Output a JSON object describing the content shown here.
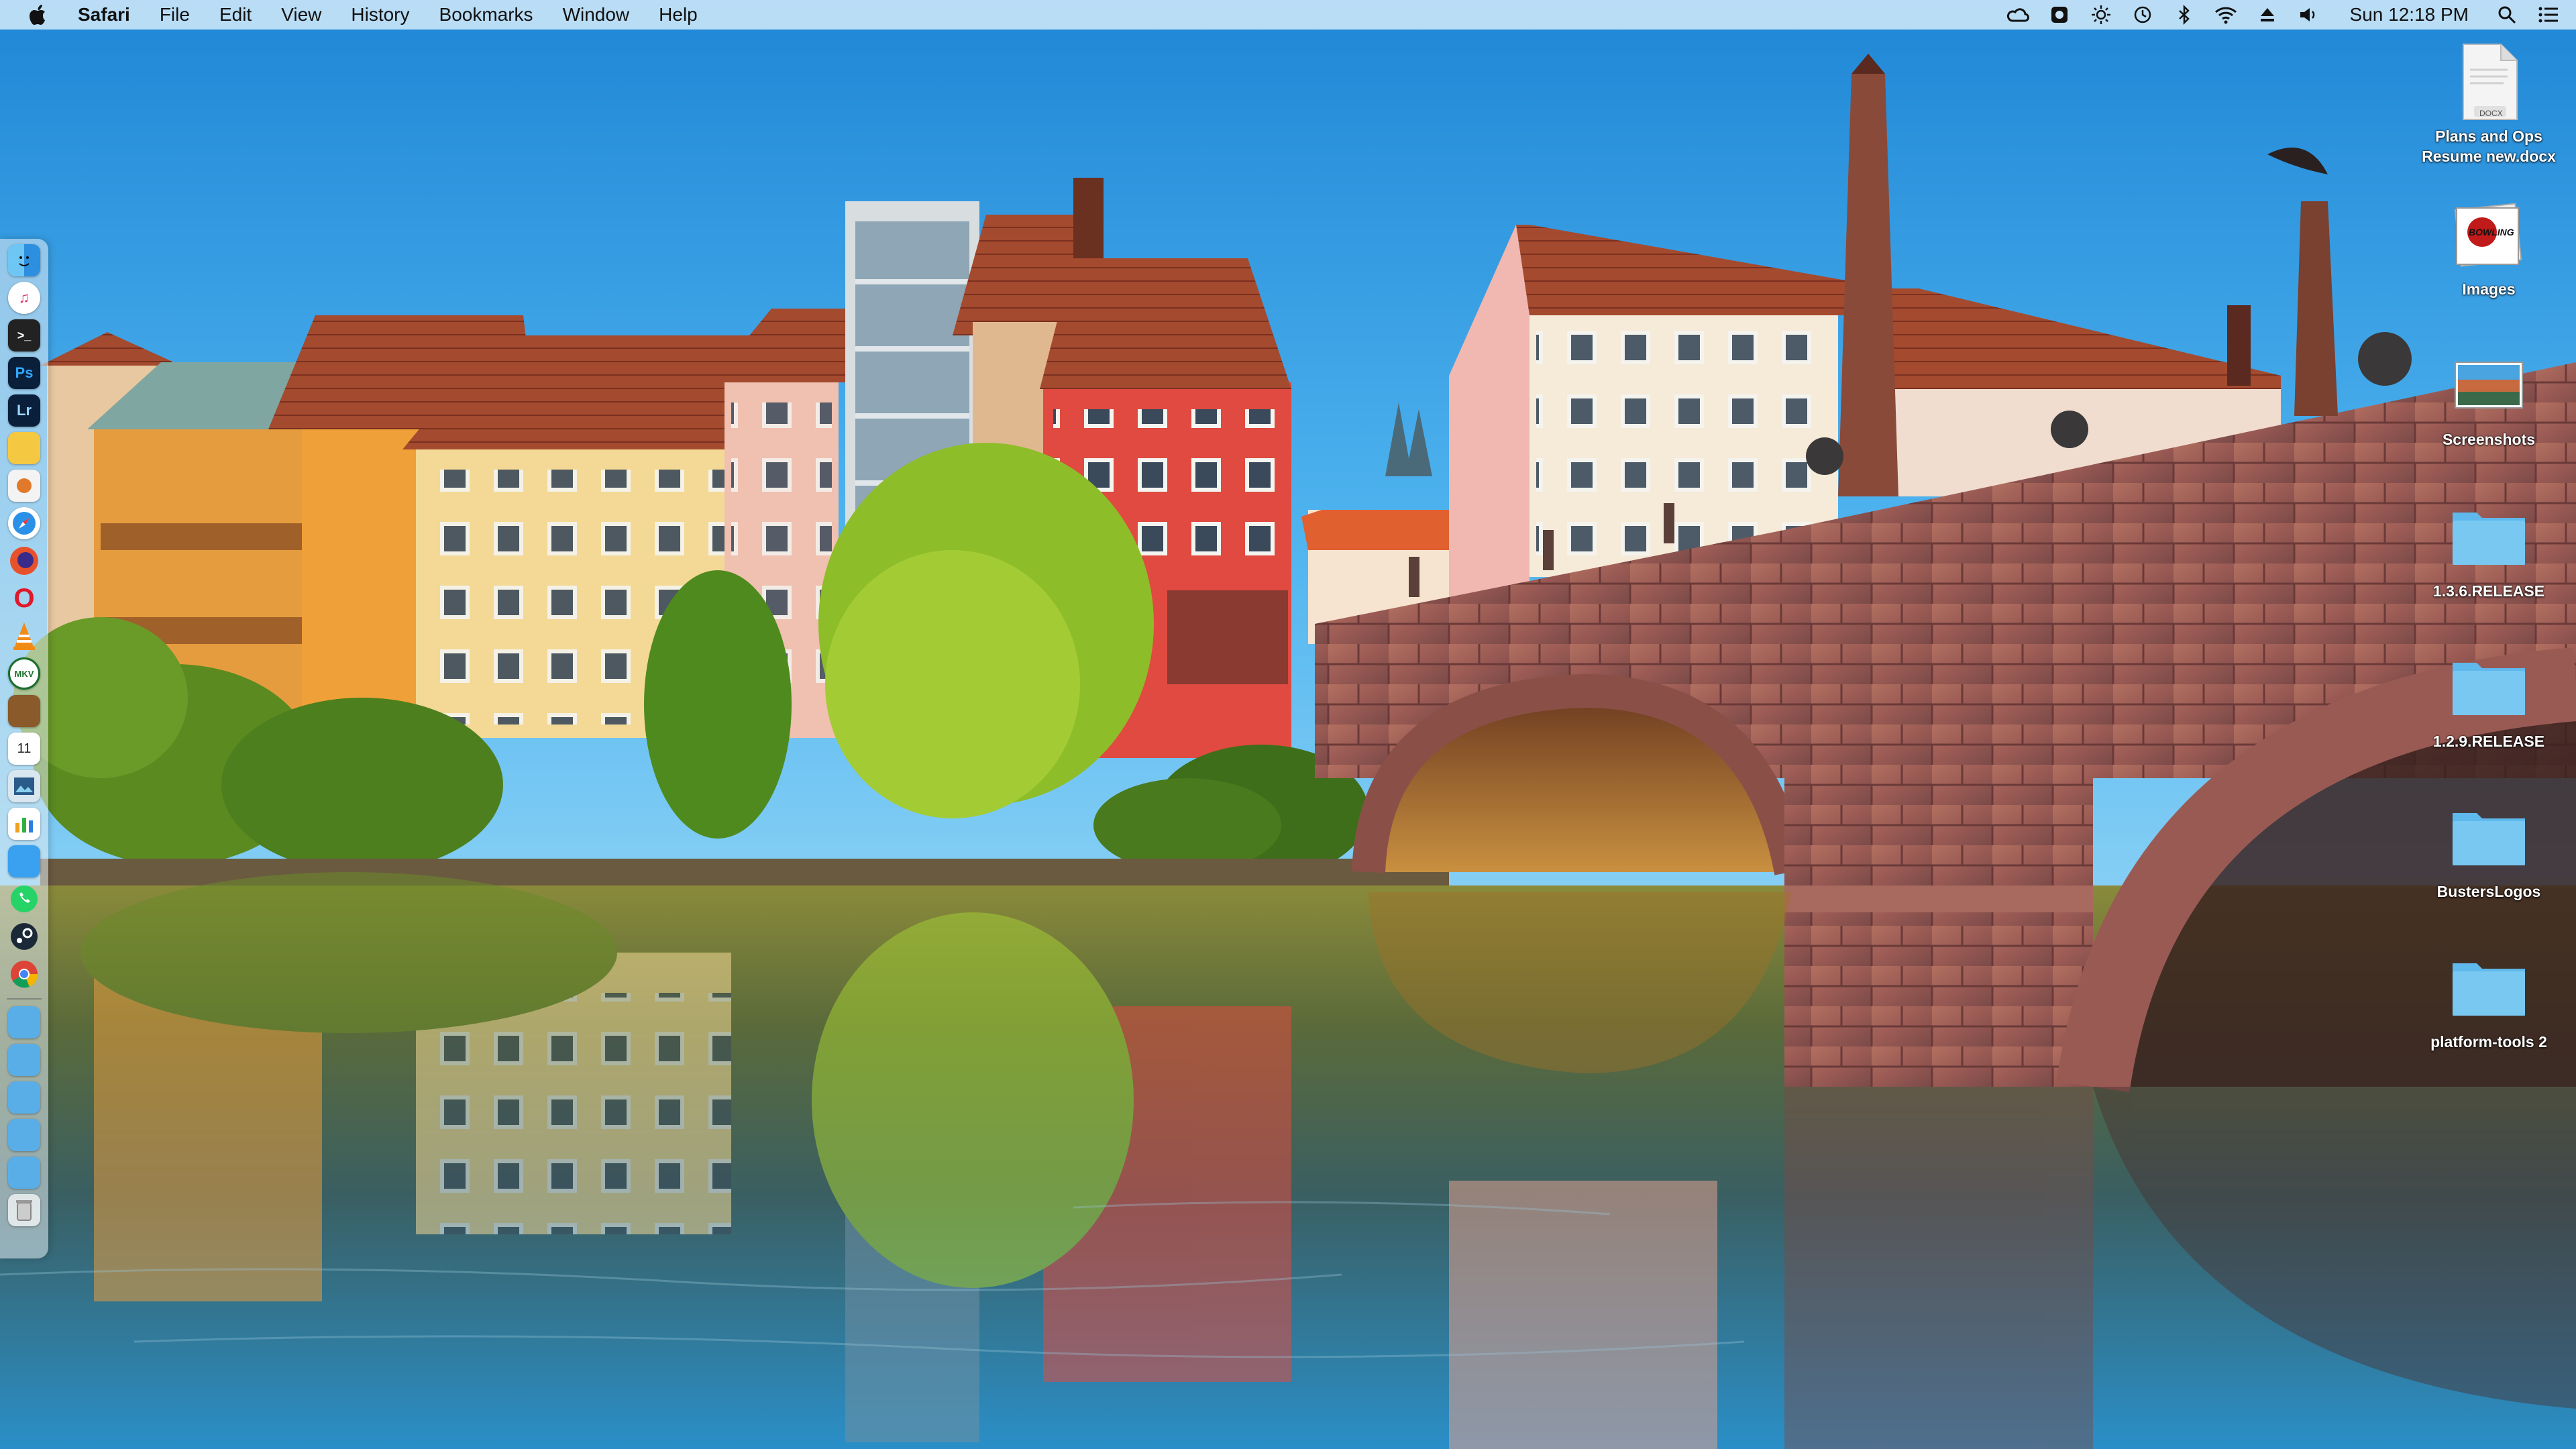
{
  "menubar": {
    "app_name": "Safari",
    "menus": [
      "File",
      "Edit",
      "View",
      "History",
      "Bookmarks",
      "Window",
      "Help"
    ],
    "clock": "Sun 12:18 PM",
    "status_icons": [
      "creative-cloud-icon",
      "app-extension-icon",
      "brightness-icon",
      "time-machine-icon",
      "bluetooth-icon",
      "wifi-icon",
      "eject-icon",
      "volume-icon",
      "spotlight-icon",
      "notification-center-icon"
    ]
  },
  "dock": {
    "apps": [
      {
        "name": "finder-icon",
        "text": ""
      },
      {
        "name": "itunes-icon",
        "text": "♫"
      },
      {
        "name": "terminal-icon",
        "text": ">_"
      },
      {
        "name": "photoshop-icon",
        "text": "Ps"
      },
      {
        "name": "lightroom-icon",
        "text": "Lr"
      },
      {
        "name": "notes-icon",
        "text": ""
      },
      {
        "name": "app-icon",
        "text": ""
      },
      {
        "name": "safari-icon",
        "text": ""
      },
      {
        "name": "firefox-icon",
        "text": ""
      },
      {
        "name": "opera-icon",
        "text": "O"
      },
      {
        "name": "vlc-icon",
        "text": ""
      },
      {
        "name": "mkv-icon",
        "text": "MKV"
      },
      {
        "name": "book-icon",
        "text": ""
      },
      {
        "name": "calendar-icon",
        "text": "11"
      },
      {
        "name": "preview-icon",
        "text": ""
      },
      {
        "name": "numbers-icon",
        "text": ""
      },
      {
        "name": "app-store-icon",
        "text": ""
      },
      {
        "name": "whatsapp-icon",
        "text": ""
      },
      {
        "name": "steam-icon",
        "text": ""
      },
      {
        "name": "chrome-icon",
        "text": ""
      }
    ],
    "stacks": [
      {
        "name": "applications-folder-icon"
      },
      {
        "name": "downloads-folder-icon"
      },
      {
        "name": "documents-folder-icon"
      },
      {
        "name": "desktop-folder-icon"
      },
      {
        "name": "screenshots-folder-icon"
      },
      {
        "name": "trash-icon"
      }
    ]
  },
  "desktop_icons": [
    {
      "label": "Plans and Ops Resume new.docx",
      "type": "docx",
      "badge": "DOCX"
    },
    {
      "label": "Images",
      "type": "image-stack",
      "badge": "BOWLING"
    },
    {
      "label": "Screenshots",
      "type": "screenshot"
    },
    {
      "label": "1.3.6.RELEASE",
      "type": "folder"
    },
    {
      "label": "1.2.9.RELEASE",
      "type": "folder"
    },
    {
      "label": "BustersLogos",
      "type": "folder"
    },
    {
      "label": "platform-tools 2",
      "type": "folder"
    }
  ],
  "colors": {
    "folder": "#5fb9ec",
    "sky_top": "#1f86d6",
    "water": "#3b6e6e"
  }
}
